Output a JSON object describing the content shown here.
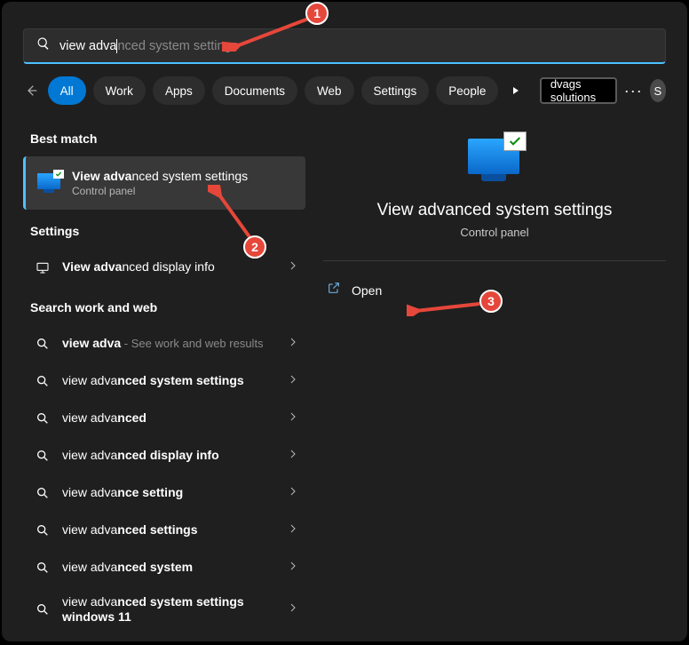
{
  "search": {
    "typed": "view adva",
    "ghost": "nced system settings"
  },
  "tabs": {
    "items": [
      "All",
      "Work",
      "Apps",
      "Documents",
      "Web",
      "Settings",
      "People"
    ],
    "active_index": 0
  },
  "extension": {
    "label": "dvags solutions"
  },
  "avatar": {
    "initial": "S"
  },
  "left_panel": {
    "best_match_label": "Best match",
    "best_match_item": {
      "title_strong": "View adva",
      "title_rest": "nced system settings",
      "subtitle": "Control panel"
    },
    "settings_label": "Settings",
    "settings_items": [
      {
        "strong": "View adva",
        "rest": "nced display info"
      }
    ],
    "workweb_label": "Search work and web",
    "workweb_items": [
      {
        "pre": "",
        "strong": "view adva",
        "rest": "",
        "sub": " - See work and web results"
      },
      {
        "pre": "view adva",
        "strong": "nced system settings",
        "rest": "",
        "sub": ""
      },
      {
        "pre": "view adva",
        "strong": "nced",
        "rest": "",
        "sub": ""
      },
      {
        "pre": "view adva",
        "strong": "nced display info",
        "rest": "",
        "sub": ""
      },
      {
        "pre": "view adva",
        "strong": "nce setting",
        "rest": "",
        "sub": ""
      },
      {
        "pre": "view adva",
        "strong": "nced settings",
        "rest": "",
        "sub": ""
      },
      {
        "pre": "view adva",
        "strong": "nced system",
        "rest": "",
        "sub": ""
      },
      {
        "pre": "view adva",
        "strong": "nced system settings windows 11",
        "rest": "",
        "sub": ""
      }
    ]
  },
  "preview": {
    "title": "View advanced system settings",
    "subtitle": "Control panel",
    "open_label": "Open"
  },
  "callouts": {
    "c1": "1",
    "c2": "2",
    "c3": "3"
  }
}
